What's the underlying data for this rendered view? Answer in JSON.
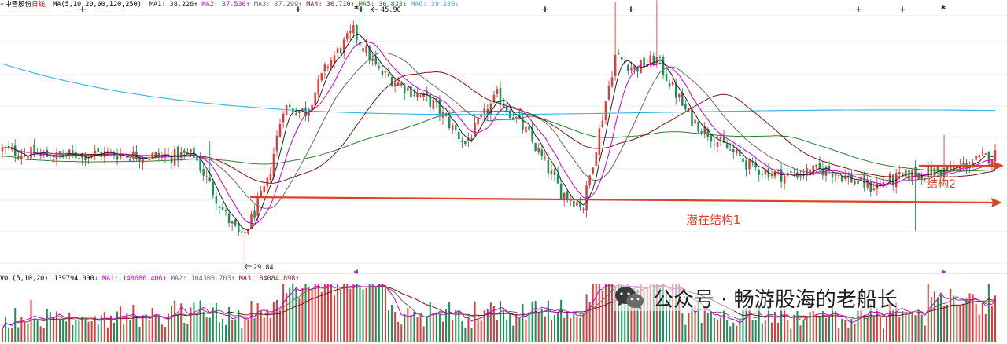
{
  "header": {
    "stock_name": "中晋股份",
    "period": "日线",
    "ma_params": "MA(5,10,20,60,120,250)",
    "ma_readings": [
      {
        "label": "MA1:",
        "value": "38.226",
        "arrow": "↑",
        "color": "#222222"
      },
      {
        "label": "MA2:",
        "value": "37.536",
        "arrow": "↑",
        "color": "#cc00cc"
      },
      {
        "label": "MA3:",
        "value": "37.299",
        "arrow": "↑",
        "color": "#6a6a6a"
      },
      {
        "label": "MA4:",
        "value": "36.710",
        "arrow": "↑",
        "color": "#7a1515"
      },
      {
        "label": "MA5:",
        "value": "36.833",
        "arrow": "↓",
        "color": "#2e7d32"
      },
      {
        "label": "MA6:",
        "value": "39.280",
        "arrow": "↓",
        "color": "#33b6e0"
      }
    ]
  },
  "volume_header": {
    "params": "VOL(5,10,20)",
    "vol_value": "139794.000",
    "vol_arrow": "↓",
    "ma_readings": [
      {
        "label": "MA1:",
        "value": "148686.406",
        "arrow": "↑",
        "color": "#cc00cc"
      },
      {
        "label": "MA2:",
        "value": "104300.703",
        "arrow": "↑",
        "color": "#6a6a6a"
      },
      {
        "label": "MA3:",
        "value": "84084.898",
        "arrow": "↑",
        "color": "#7a1515"
      }
    ]
  },
  "annotations": {
    "high_label": "45.90",
    "low_label": "29.84",
    "structure1_label": "潜在结构1",
    "structure2_label": "结构2",
    "arrow_color": "#d9432b"
  },
  "watermark": {
    "text": "公众号 · 畅游股海的老船长",
    "icon": "wechat-icon"
  },
  "colors": {
    "up": "#e03b3b",
    "down": "#1f8f5a",
    "ma1": "#222222",
    "ma2": "#cc00cc",
    "ma3": "#6a6a6a",
    "ma4": "#7a1515",
    "ma5": "#2e7d32",
    "ma6": "#33b6e0",
    "grid": "#e4e4e4"
  },
  "chart_data": {
    "type": "candlestick",
    "price_extremes": {
      "high": 45.9,
      "low": 29.84
    },
    "price_trend_keypoints": [
      [
        0,
        37.1
      ],
      [
        16,
        36.7
      ],
      [
        30,
        36.9
      ],
      [
        50,
        36.7
      ],
      [
        60,
        36.8
      ],
      [
        70,
        33.0
      ],
      [
        75,
        31.5
      ],
      [
        83,
        35.0
      ],
      [
        88,
        39.8
      ],
      [
        95,
        39.5
      ],
      [
        102,
        42.5
      ],
      [
        110,
        44.5
      ],
      [
        118,
        42.0
      ],
      [
        135,
        40.0
      ],
      [
        145,
        37.5
      ],
      [
        155,
        40.5
      ],
      [
        165,
        38.0
      ],
      [
        175,
        34.5
      ],
      [
        182,
        33.6
      ],
      [
        192,
        43.0
      ],
      [
        198,
        42.2
      ],
      [
        205,
        42.8
      ],
      [
        215,
        39.2
      ],
      [
        225,
        37.5
      ],
      [
        235,
        36.0
      ],
      [
        245,
        35.5
      ],
      [
        258,
        35.9
      ],
      [
        272,
        34.8
      ],
      [
        285,
        35.6
      ],
      [
        298,
        35.9
      ],
      [
        310,
        36.8
      ]
    ],
    "horizontal_levels": [
      {
        "name": "潜在结构1",
        "start_index": 79,
        "price": 33.2
      },
      {
        "name": "结构2",
        "start_index": 286,
        "price": 35.4
      }
    ]
  }
}
